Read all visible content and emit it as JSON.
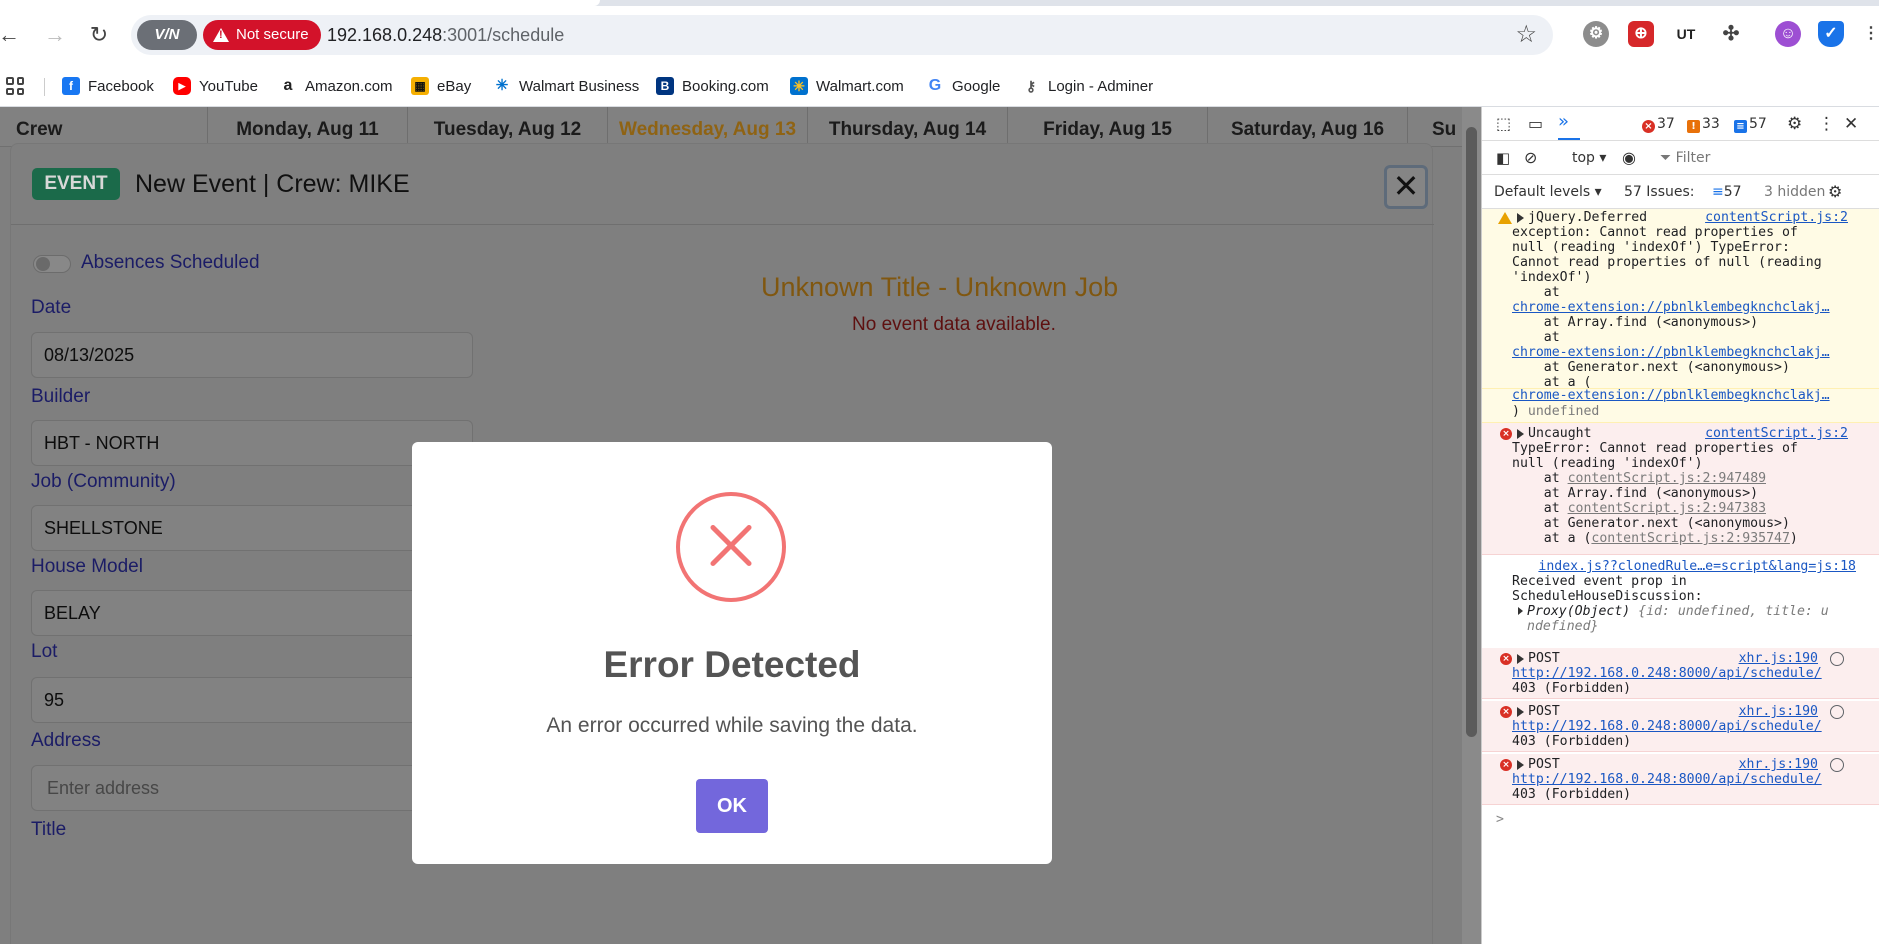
{
  "browser": {
    "url_host": "192.168.0.248",
    "url_rest": ":3001/schedule",
    "vpn_label": "V/N",
    "not_secure_label": "Not secure"
  },
  "bookmarks": [
    {
      "label": "Facebook",
      "icon": "facebook-icon",
      "color": "#1877f2"
    },
    {
      "label": "YouTube",
      "icon": "youtube-icon",
      "color": "#ff0000"
    },
    {
      "label": "Amazon.com",
      "icon": "amazon-icon",
      "color": "#222222"
    },
    {
      "label": "eBay",
      "icon": "ebay-icon",
      "color": "#e53238"
    },
    {
      "label": "Walmart Business",
      "icon": "walmart-icon",
      "color": "#0071ce"
    },
    {
      "label": "Booking.com",
      "icon": "booking-icon",
      "color": "#003580"
    },
    {
      "label": "Walmart.com",
      "icon": "walmart-icon",
      "color": "#0071ce"
    },
    {
      "label": "Google",
      "icon": "google-icon",
      "color": "#4285f4"
    },
    {
      "label": "Login - Adminer",
      "icon": "adminer-icon",
      "color": "#555555"
    }
  ],
  "calendar": {
    "crew_header": "Crew",
    "days": [
      "Monday, Aug 11",
      "Tuesday, Aug 12",
      "Wednesday, Aug 13",
      "Thursday, Aug 14",
      "Friday, Aug 15",
      "Saturday, Aug 16",
      "Su"
    ]
  },
  "event_modal": {
    "badge": "EVENT",
    "title": "New Event | Crew: MIKE",
    "close": "✕",
    "absences_label": "Absences Scheduled",
    "fields": {
      "date_label": "Date",
      "date_value": "08/13/2025",
      "builder_label": "Builder",
      "builder_value": "HBT - NORTH",
      "job_label": "Job (Community)",
      "job_value": "SHELLSTONE",
      "house_label": "House Model",
      "house_value": "BELAY",
      "lot_label": "Lot",
      "lot_value": "95",
      "address_label": "Address",
      "address_placeholder": "Enter address",
      "title_label": "Title"
    },
    "unknown_title": "Unknown Title - Unknown Job",
    "no_data": "No event data available."
  },
  "alert": {
    "title": "Error Detected",
    "text": "An error occurred while saving the data.",
    "ok": "OK",
    "icon_color": "#f27474",
    "button_color": "#7367dc"
  },
  "devtools": {
    "errors": "37",
    "warnings": "33",
    "messages": "57",
    "context": "top",
    "filter_placeholder": "Filter",
    "levels": "Default levels",
    "issues_label": "57 Issues:",
    "issues_count": "57",
    "hidden": "3 hidden",
    "logs": {
      "w1": {
        "src": "contentScript.js:2",
        "l1": "jQuery.Deferred",
        "l2": "exception: Cannot read properties of",
        "l3": "null (reading 'indexOf') TypeError:",
        "l4": "Cannot read properties of null (reading",
        "l5": "'indexOf')",
        "l6": "    at",
        "l7": "chrome-extension://pbnlklembegknchclakj…",
        "l8": "    at Array.find (<anonymous>)",
        "l9": "    at",
        "l10": "chrome-extension://pbnlklembegknchclakj…",
        "l11": "    at Generator.next (<anonymous>)",
        "l12": "    at a (",
        "l13": "chrome-extension://pbnlklembegknchclakj…",
        "l14a": ")",
        "l14b": "undefined"
      },
      "e1": {
        "src": "contentScript.js:2",
        "l1": "Uncaught",
        "l2": "TypeError: Cannot read properties of",
        "l3": "null (reading 'indexOf')",
        "l4a": "    at ",
        "l4b": "contentScript.js:2:947489",
        "l5": "    at Array.find (<anonymous>)",
        "l6a": "    at ",
        "l6b": "contentScript.js:2:947383",
        "l7": "    at Generator.next (<anonymous>)",
        "l8a": "    at a (",
        "l8b": "contentScript.js:2:935747",
        "l8c": ")"
      },
      "i1": {
        "src": "index.js??clonedRule…e=script&lang=js:18",
        "l1": "Received event prop in",
        "l2": "ScheduleHouseDiscussion:",
        "l3a": "Proxy(Object) ",
        "l3b": "{id: undefined, title: u",
        "l4": "ndefined}"
      },
      "p": {
        "method": "POST",
        "src": "xhr.js:190",
        "url": "http://192.168.0.248:8000/api/schedule/",
        "status": "403 (Forbidden)"
      }
    },
    "prompt": ">"
  }
}
